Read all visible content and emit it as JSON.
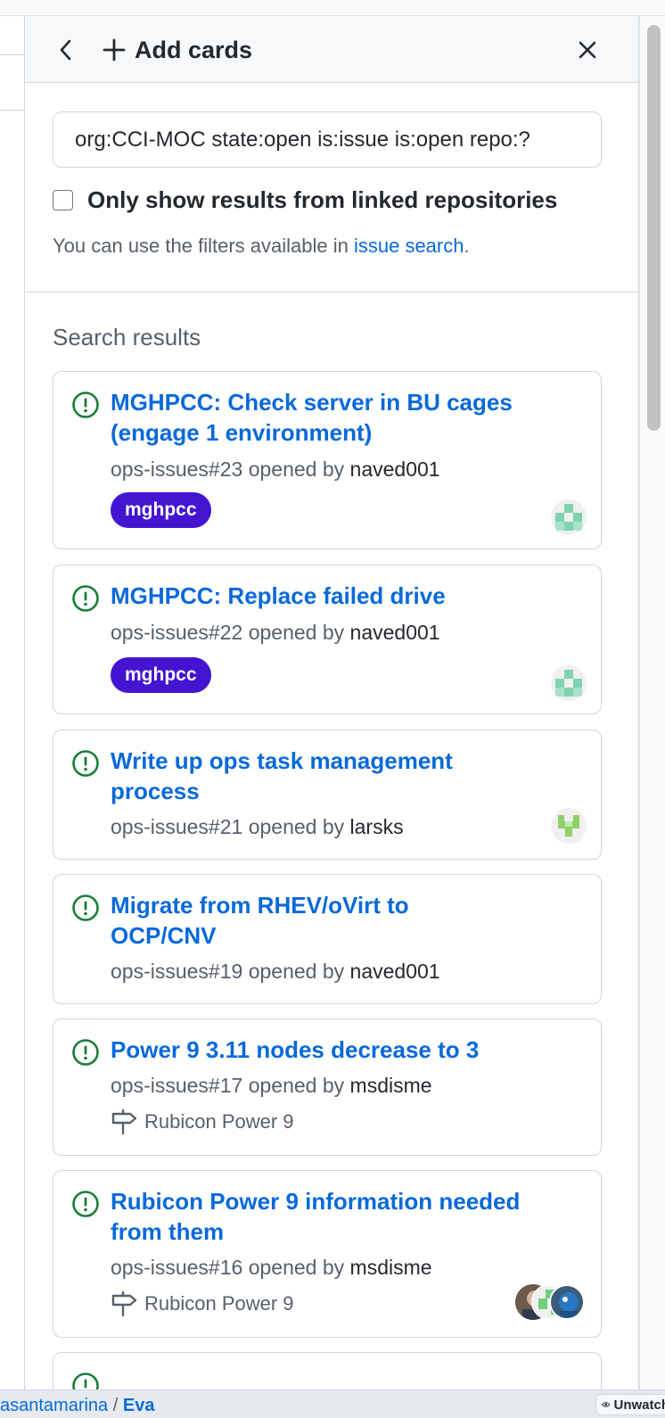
{
  "panel": {
    "title": "Add cards"
  },
  "search": {
    "value": "org:CCI-MOC state:open is:issue is:open repo:?",
    "checkbox_label": "Only show results from linked repositories",
    "hint_prefix": "You can use the filters available in ",
    "hint_link": "issue search",
    "hint_suffix": "."
  },
  "results": {
    "title": "Search results",
    "opened_by": " opened by ",
    "cards": [
      {
        "title": "MGHPCC: Check server in BU cages (engage 1 environment)",
        "ref": "ops-issues#23",
        "author": "naved001",
        "label": "mghpcc"
      },
      {
        "title": "MGHPCC: Replace failed drive",
        "ref": "ops-issues#22",
        "author": "naved001",
        "label": "mghpcc"
      },
      {
        "title": "Write up ops task management process",
        "ref": "ops-issues#21",
        "author": "larsks"
      },
      {
        "title": "Migrate from RHEV/oVirt to OCP/CNV",
        "ref": "ops-issues#19",
        "author": "naved001"
      },
      {
        "title": "Power 9 3.11 nodes decrease to 3",
        "ref": "ops-issues#17",
        "author": "msdisme",
        "milestone": "Rubicon Power 9"
      },
      {
        "title": "Rubicon Power 9 information needed from them",
        "ref": "ops-issues#16",
        "author": "msdisme",
        "milestone": "Rubicon Power 9"
      }
    ]
  },
  "footer": {
    "owner": "asantamarina",
    "separator": " / ",
    "repo": "Eva",
    "watch_label": "Unwatch"
  },
  "colors": {
    "link": "#0969da",
    "open_issue": "#1a7f37",
    "label_bg": "#4315d1"
  }
}
